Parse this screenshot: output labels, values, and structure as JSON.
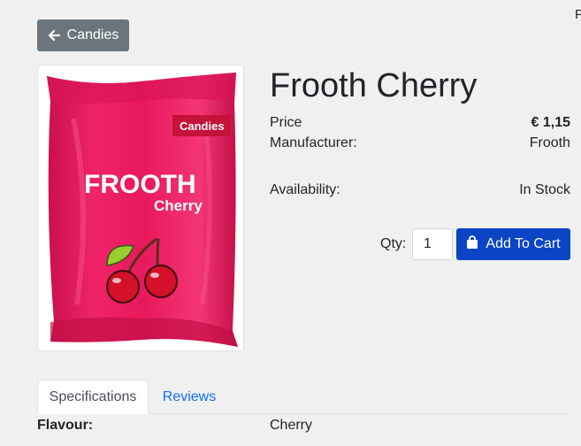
{
  "header": {
    "clipped_text": "F"
  },
  "back_button": {
    "label": "Candies",
    "icon": "arrow-left-icon"
  },
  "product": {
    "title": "Frooth Cherry",
    "image": {
      "brand_text": "FROOTH",
      "flavor_text": "Cherry",
      "tag_text": "Candies",
      "bag_color": "#e8185c"
    },
    "details": [
      {
        "label": "Price",
        "value": "€ 1,15"
      },
      {
        "label": "Manufacturer:",
        "value": "Frooth"
      },
      {
        "label": "Availability:",
        "value": "In Stock"
      }
    ],
    "qty_label": "Qty:",
    "qty_value": "1",
    "add_to_cart": {
      "label": "Add To Cart",
      "icon": "shopping-bag-icon",
      "color": "#0b45c4"
    }
  },
  "tabs": [
    {
      "label": "Specifications",
      "active": true
    },
    {
      "label": "Reviews",
      "active": false
    }
  ],
  "specifications": [
    {
      "label": "Flavour:",
      "value": "Cherry"
    }
  ]
}
